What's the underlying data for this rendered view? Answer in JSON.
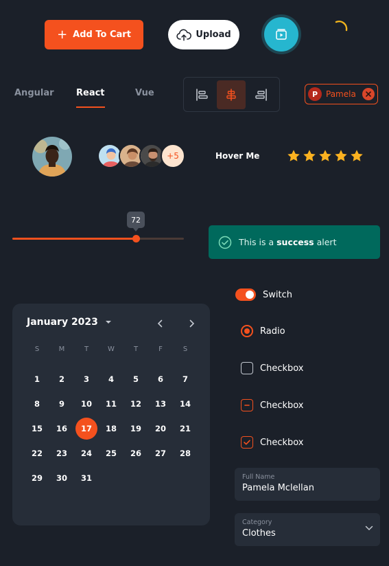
{
  "buttons": {
    "add_to_cart": "Add To Cart",
    "upload": "Upload"
  },
  "tabs": [
    {
      "label": "Angular",
      "active": false
    },
    {
      "label": "React",
      "active": true
    },
    {
      "label": "Vue",
      "active": false
    }
  ],
  "chip": {
    "initial": "P",
    "label": "Pamela"
  },
  "avatar_group": {
    "more": "+5"
  },
  "hover_label": "Hover Me",
  "rating": {
    "value": 5,
    "max": 5
  },
  "slider": {
    "value": 72,
    "display": "72",
    "min": 0,
    "max": 100
  },
  "alert": {
    "prefix": "This is a ",
    "strong": "success",
    "suffix": " alert"
  },
  "calendar": {
    "month": "January 2023",
    "weekdays": [
      "S",
      "M",
      "T",
      "W",
      "T",
      "F",
      "S"
    ],
    "first_weekday": 0,
    "days": 31,
    "selected": 17
  },
  "controls": {
    "switch": "Switch",
    "radio": "Radio",
    "checkbox_unchecked": "Checkbox",
    "checkbox_indeterminate": "Checkbox",
    "checkbox_checked": "Checkbox"
  },
  "fields": {
    "full_name": {
      "label": "Full Name",
      "value": "Pamela Mclellan"
    },
    "category": {
      "label": "Category",
      "value": "Clothes"
    }
  },
  "colors": {
    "background": "#1b2029",
    "accent": "#f4511e",
    "teal": "#26b6cf",
    "success": "#00695c",
    "star": "#fbb220",
    "card": "#262d38"
  },
  "icons": {
    "cart": "plus-icon",
    "upload": "cloud-upload-icon",
    "play": "video-play-icon",
    "loading": "spinner-icon",
    "align": [
      "align-left-icon",
      "align-center-icon",
      "align-right-icon"
    ],
    "chip_remove": "close-icon",
    "alert": "check-circle-icon",
    "rating": "star-icon"
  }
}
